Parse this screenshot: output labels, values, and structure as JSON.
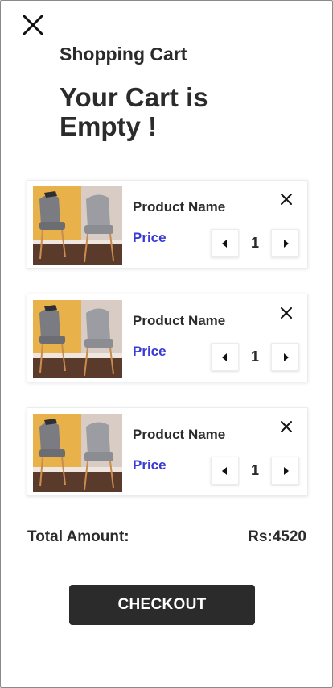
{
  "header": {
    "subtitle": "Shopping Cart",
    "headline": "Your Cart is Empty !",
    "close_icon": "close-icon"
  },
  "cart": {
    "items": [
      {
        "name": "Product Name",
        "price": "Price",
        "quantity": "1"
      },
      {
        "name": "Product Name",
        "price": "Price",
        "quantity": "1"
      },
      {
        "name": "Product Name",
        "price": "Price",
        "quantity": "1"
      }
    ]
  },
  "summary": {
    "total_label": "Total Amount:",
    "total_value": "Rs:4520"
  },
  "checkout": {
    "label": "CHECKOUT"
  },
  "colors": {
    "text": "#2b2b2b",
    "price": "#3a3ad6",
    "button_bg": "#2b2b2b",
    "button_text": "#ffffff"
  }
}
